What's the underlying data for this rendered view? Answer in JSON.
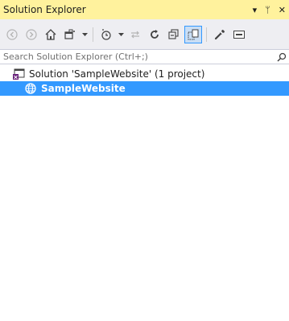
{
  "window": {
    "title": "Solution Explorer",
    "actions": {
      "dropdown_glyph": "▾",
      "pin_glyph": "ᛘ",
      "close_glyph": "✕"
    }
  },
  "toolbar": {
    "buttons": [
      {
        "name": "back-button",
        "icon": "back-arrow-icon"
      },
      {
        "name": "forward-button",
        "icon": "forward-arrow-icon"
      },
      {
        "name": "home-button",
        "icon": "home-icon"
      },
      {
        "name": "switch-views-button",
        "icon": "switch-views-icon"
      },
      {
        "name": "pending-changes-filter-button",
        "icon": "clock-icon"
      },
      {
        "name": "sync-with-active-document-button",
        "icon": "sync-arrows-icon"
      },
      {
        "name": "refresh-button",
        "icon": "refresh-icon"
      },
      {
        "name": "collapse-all-button",
        "icon": "collapse-all-icon"
      },
      {
        "name": "show-all-files-button",
        "icon": "show-all-files-icon",
        "checked": true
      },
      {
        "name": "properties-button",
        "icon": "wrench-icon"
      },
      {
        "name": "preview-selected-items-button",
        "icon": "preview-icon"
      }
    ]
  },
  "search": {
    "placeholder": "Search Solution Explorer (Ctrl+;)",
    "value": ""
  },
  "tree": {
    "solution": {
      "label": "Solution 'SampleWebsite' (1 project)"
    },
    "project": {
      "label": "SampleWebsite",
      "selected": true
    }
  },
  "colors": {
    "title_bg": "#fff29d",
    "toolbar_bg": "#eeeef2",
    "selection_bg": "#3399ff",
    "icon_gray": "#b4b4b4",
    "icon_dark": "#424242",
    "vs_purple": "#68217a"
  }
}
